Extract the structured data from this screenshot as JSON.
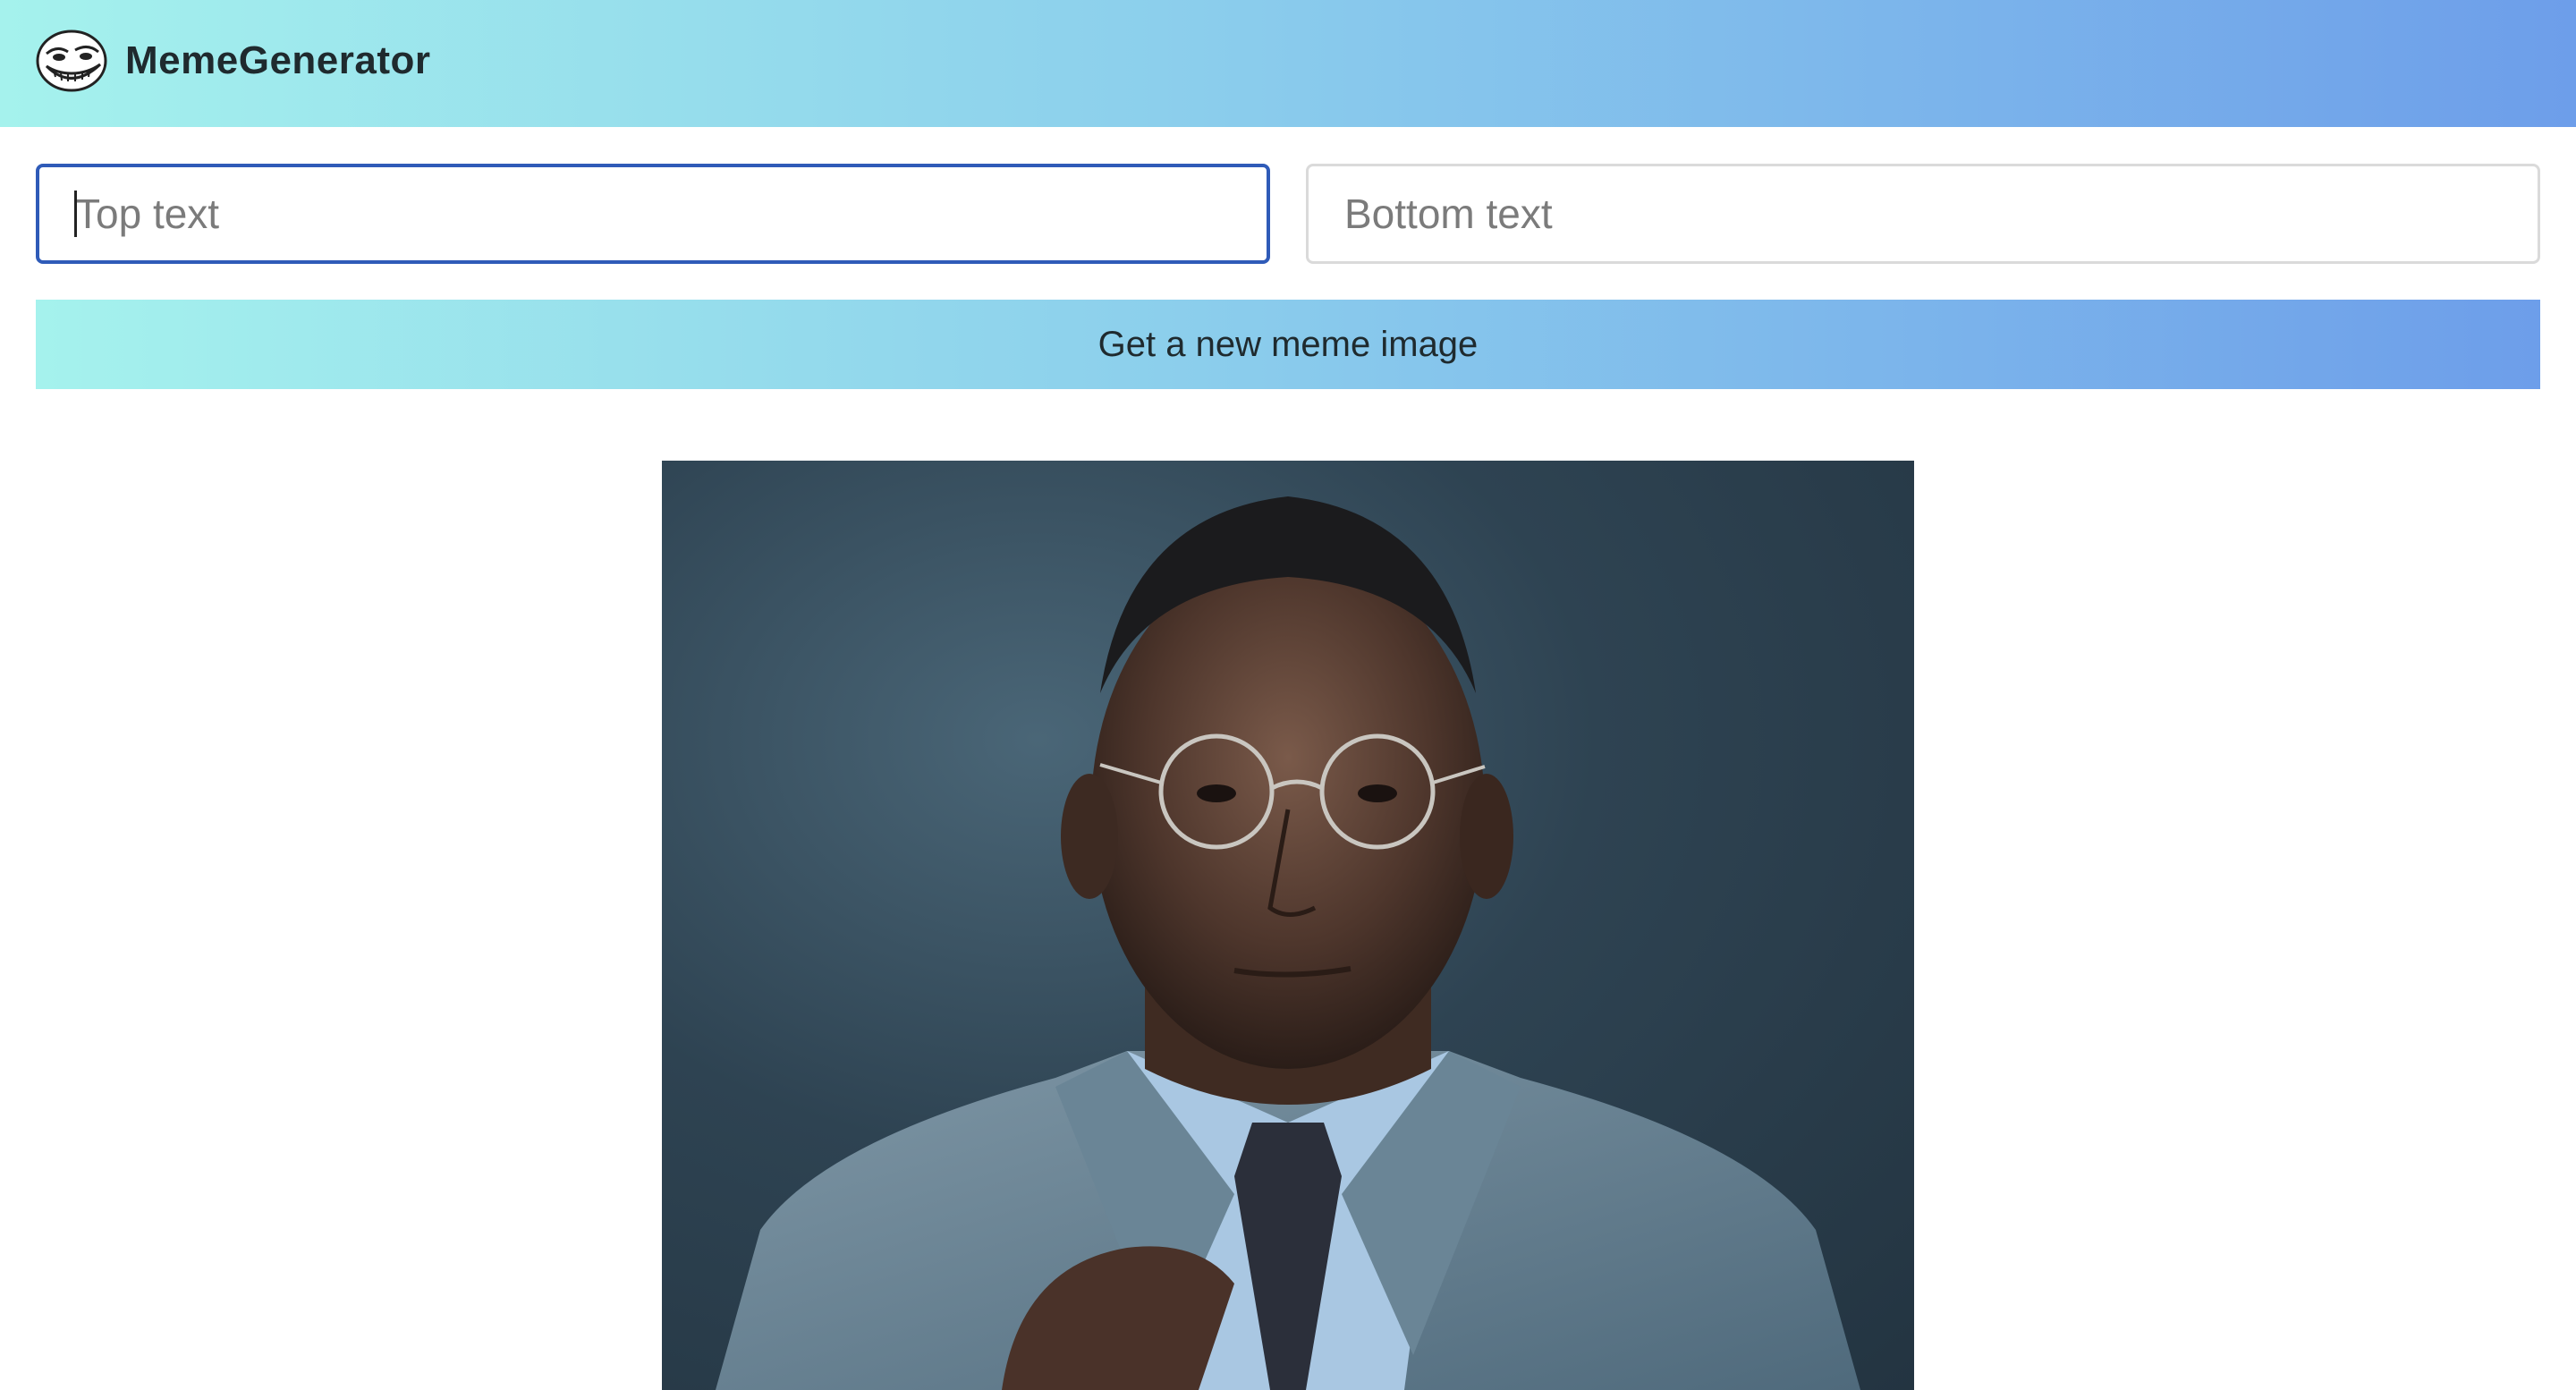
{
  "header": {
    "title": "MemeGenerator",
    "logo_icon": "trollface-icon"
  },
  "form": {
    "top_text": {
      "value": "",
      "placeholder": "Top text"
    },
    "bottom_text": {
      "value": "",
      "placeholder": "Bottom text"
    },
    "button_label": "Get a new meme image"
  },
  "meme": {
    "image_icon": "portrait-photo"
  },
  "colors": {
    "gradient_start": "#a5f2ed",
    "gradient_end": "#6d9eea",
    "focus_border": "#2f5bb8",
    "text": "#1f2a2e"
  }
}
